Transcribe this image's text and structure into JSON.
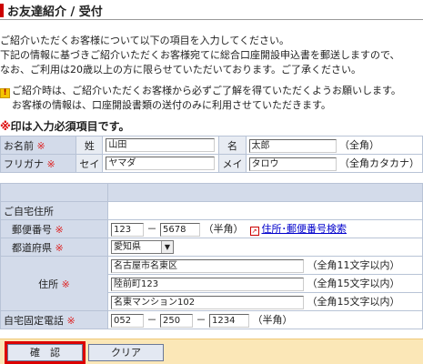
{
  "header": {
    "title": "お友達紹介 / 受付"
  },
  "intro": {
    "line1": "ご紹介いただくお客様について以下の項目を入力してください。",
    "line2": "下記の情報に基づきご紹介いただくお客様宛てに総合口座開設申込書を郵送しますので、",
    "line3": "なお、ご利用は20歳以上の方に限らせていただいております。ご了承ください。"
  },
  "notice": {
    "icon": "exclamation-icon",
    "line1": "ご紹介時は、ご紹介いただくお客様から必ずご了解を得ていただくようお願いします。",
    "line2": "お客様の情報は、口座開設書類の送付のみに利用させていただきます。"
  },
  "required_note": {
    "mark": "※",
    "text": "印は入力必須項目です。"
  },
  "required_mark": "※",
  "name": {
    "label": "お名前",
    "sei_label": "姓",
    "sei_value": "山田",
    "mei_label": "名",
    "mei_value": "太郎",
    "hint": "（全角）"
  },
  "kana": {
    "label": "フリガナ",
    "sei_label": "セイ",
    "sei_value": "ヤマダ",
    "mei_label": "メイ",
    "mei_value": "タロウ",
    "hint": "（全角カタカナ）"
  },
  "address_section": {
    "label": "ご自宅住所"
  },
  "postal": {
    "label": "郵便番号",
    "part1": "123",
    "separator": "－",
    "part2": "5678",
    "hint": "（半角）",
    "search_link": "住所･郵便番号検索"
  },
  "prefecture": {
    "label": "都道府県",
    "value": "愛知県"
  },
  "address": {
    "label": "住所",
    "line1": "名古屋市名東区",
    "line1_hint": "（全角11文字以内）",
    "line2": "陸前町123",
    "line2_hint": "（全角15文字以内）",
    "line3": "名東マンション102",
    "line3_hint": "（全角15文字以内）"
  },
  "phone": {
    "label": "自宅固定電話",
    "part1": "052",
    "part2": "250",
    "part3": "1234",
    "separator": "－",
    "hint": "（半角）"
  },
  "buttons": {
    "confirm": "確　認",
    "clear": "クリア"
  },
  "colors": {
    "accent": "#cc0000",
    "label_bg": "#d3dbea",
    "button_bar": "#fbe7b7",
    "highlight": "#dd0000"
  }
}
